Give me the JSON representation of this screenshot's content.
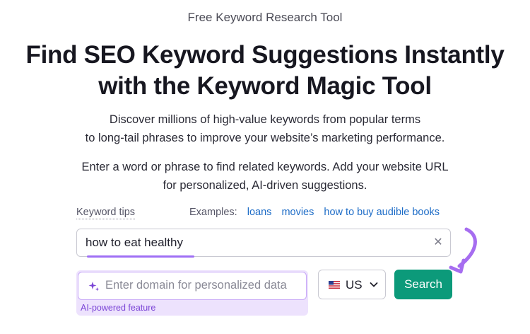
{
  "header": {
    "eyebrow": "Free Keyword Research Tool",
    "title_line1": "Find SEO Keyword Suggestions Instantly",
    "title_line2": "with the Keyword Magic Tool"
  },
  "intro": {
    "line1": "Discover millions of high-value keywords from popular terms",
    "line2": "to long-tail phrases to improve your website’s marketing performance."
  },
  "instructions": {
    "line1": "Enter a word or phrase to find related keywords. Add your website URL",
    "line2": "for personalized, AI-driven suggestions."
  },
  "tips": {
    "link_label": "Keyword tips",
    "examples_label": "Examples:",
    "examples": [
      "loans",
      "movies",
      "how to buy audible books"
    ]
  },
  "keyword_input": {
    "value": "how to eat healthy",
    "clear_icon": "close-icon"
  },
  "domain_input": {
    "placeholder": "Enter domain for personalized data",
    "value": "",
    "icon": "sparkle-icon",
    "feature_label": "AI-powered feature"
  },
  "country_select": {
    "selected": "US",
    "flag_icon": "us-flag-icon"
  },
  "search_button": {
    "label": "Search"
  },
  "colors": {
    "primary_button": "#0c9a7a",
    "accent_purple": "#9f6ff5",
    "link_blue": "#1d6cc7",
    "ai_label": "#7b45d6"
  }
}
